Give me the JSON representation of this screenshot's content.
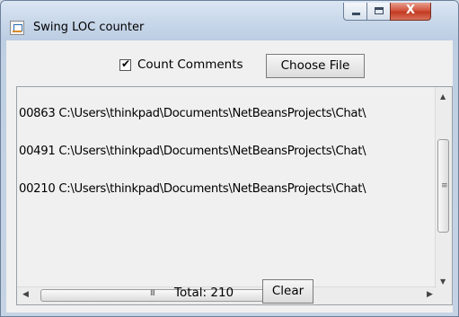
{
  "window": {
    "title": "Swing LOC counter",
    "icon": "java-app-icon",
    "controls": {
      "minimize": "minimize-icon",
      "maximize": "maximize-icon",
      "close": "X"
    }
  },
  "toolbar": {
    "count_comments_label": "Count Comments",
    "count_comments_checked": true,
    "check_glyph": "✔",
    "choose_file_label": "Choose File"
  },
  "results": {
    "items": [
      {
        "text": "00863 C:\\Users\\thinkpad\\Documents\\NetBeansProjects\\Chat\\"
      },
      {
        "text": "00491 C:\\Users\\thinkpad\\Documents\\NetBeansProjects\\Chat\\"
      },
      {
        "text": "00210 C:\\Users\\thinkpad\\Documents\\NetBeansProjects\\Chat\\"
      }
    ]
  },
  "scrollbars": {
    "up_arrow": "▲",
    "down_arrow": "▼",
    "left_arrow": "◀",
    "right_arrow": "▶",
    "h_grip": "III",
    "v_grip": "≡"
  },
  "footer": {
    "total_label": "Total: 210",
    "clear_label": "Clear"
  }
}
